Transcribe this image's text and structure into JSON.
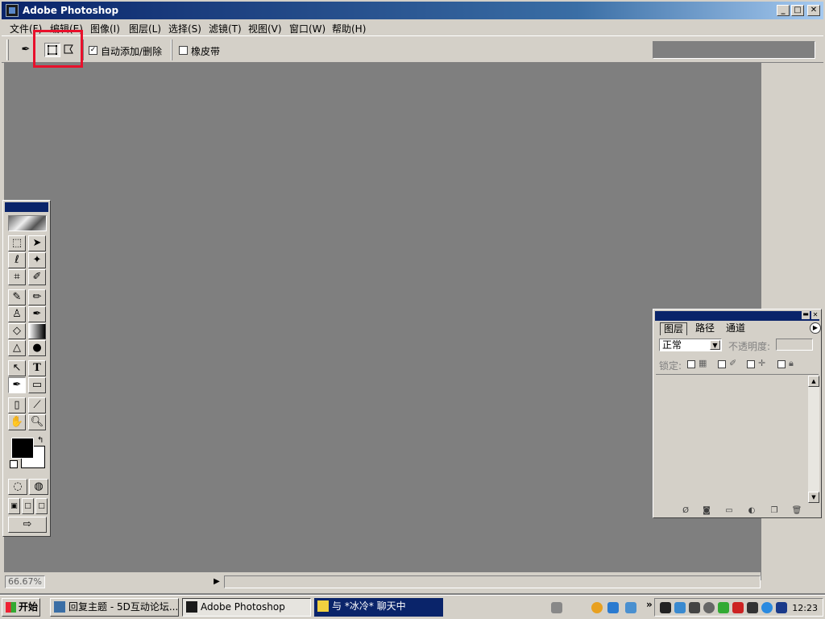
{
  "window": {
    "title": "Adobe Photoshop"
  },
  "menu": [
    "文件(F)",
    "编辑(E)",
    "图像(I)",
    "图层(L)",
    "选择(S)",
    "滤镜(T)",
    "视图(V)",
    "窗口(W)",
    "帮助(H)"
  ],
  "options": {
    "auto_add_delete_label": "自动添加/删除",
    "auto_add_delete_checked": "✓",
    "rubber_band_label": "橡皮带"
  },
  "layers_panel": {
    "tabs": [
      "图层",
      "路径",
      "通道"
    ],
    "blend_mode": "正常",
    "opacity_label": "不透明度:",
    "lock_label": "锁定:"
  },
  "status": {
    "zoom": "66.67%"
  },
  "taskbar": {
    "start_label": "开始",
    "tasks": [
      {
        "label": "回复主题 - 5D互动论坛..."
      },
      {
        "label": "Adobe Photoshop"
      },
      {
        "label": "与 *冰冷* 聊天中"
      }
    ],
    "tray_chevron": "»",
    "clock": "12:23"
  },
  "colors": {
    "titlebar": "#0a246a",
    "canvas": "#7f7f7f",
    "chrome": "#d4d0c8",
    "highlight": "#e8102b"
  }
}
